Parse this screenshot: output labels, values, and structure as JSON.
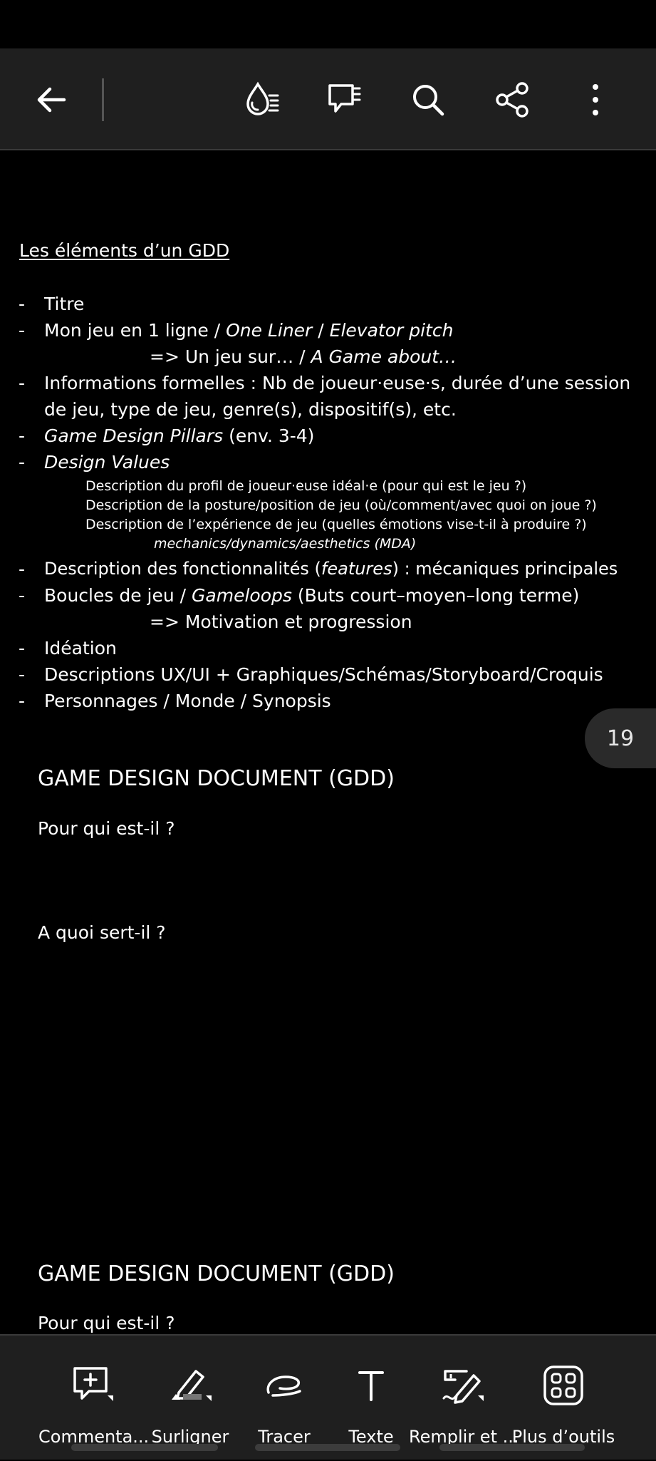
{
  "toolbar": {
    "back_icon": "arrow-left-icon",
    "reading_mode_icon": "liquid-mode-icon",
    "comments_icon": "comments-list-icon",
    "search_icon": "search-icon",
    "share_icon": "share-icon",
    "more_icon": "more-vertical-icon"
  },
  "page1": {
    "title": "Les éléments d’un GDD",
    "items": {
      "titre": "Titre",
      "mon_jeu_a": "Mon jeu en 1 ligne / ",
      "mon_jeu_b": "One Liner",
      "mon_jeu_c": " / ",
      "mon_jeu_d": "Elevator pitch",
      "jeu_sur_a": "=> Un jeu sur… / ",
      "jeu_sur_b": "A Game about…",
      "infos_1": "Informations formelles : Nb de joueur·euse·s, durée d’une session",
      "infos_2": "de jeu, type de jeu, genre(s), dispositif(s), etc.",
      "pillars_a": "Game Design Pillars",
      "pillars_b": " (env. 3-4)",
      "design_values": "Design Values",
      "desc_profil": "Description du profil de joueur·euse idéal·e (pour qui est le jeu ?)",
      "desc_posture": "Description de la posture/position de jeu (où/comment/avec quoi on joue ?)",
      "desc_experience": "Description de l’expérience de jeu (quelles émotions vise-t-il à produire ?)",
      "mda": "mechanics/dynamics/aesthetics (MDA)",
      "fonct_a": "Description des fonctionnalités (",
      "fonct_b": "features",
      "fonct_c": ") : mécaniques principales",
      "boucles_a": "Boucles de jeu / ",
      "boucles_b": "Gameloops",
      "boucles_c": " (Buts court–moyen–long terme)",
      "motivation": "=> Motivation et progression",
      "ideation": "Idéation",
      "ux": "Descriptions UX/UI + Graphiques/Schémas/Storyboard/Croquis",
      "persos": "Personnages / Monde / Synopsis"
    },
    "bullet": "-"
  },
  "page_indicator": "19",
  "page2": {
    "title": "GAME DESIGN DOCUMENT (GDD)",
    "q1": "Pour qui est-il ?",
    "q2": "A quoi sert-il ?"
  },
  "page3": {
    "title": "GAME DESIGN DOCUMENT (GDD)",
    "q1": "Pour qui est-il ?"
  },
  "bottom_tools": [
    {
      "label": "Commenta...",
      "icon": "add-comment-icon"
    },
    {
      "label": "Surligner",
      "icon": "highlighter-icon"
    },
    {
      "label": "Tracer",
      "icon": "draw-icon"
    },
    {
      "label": "Texte",
      "icon": "text-icon"
    },
    {
      "label": "Remplir et ...",
      "icon": "fill-sign-icon"
    },
    {
      "label": "Plus d’outils",
      "icon": "more-tools-icon"
    }
  ]
}
